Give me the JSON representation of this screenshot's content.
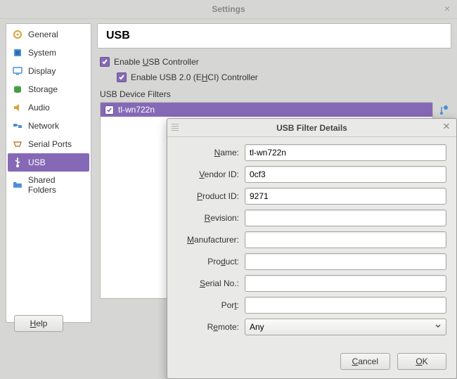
{
  "window": {
    "title": "Settings"
  },
  "sidebar": {
    "items": [
      {
        "label": "General",
        "icon": "gear",
        "selected": false
      },
      {
        "label": "System",
        "icon": "chip",
        "selected": false
      },
      {
        "label": "Display",
        "icon": "monitor",
        "selected": false
      },
      {
        "label": "Storage",
        "icon": "disk",
        "selected": false
      },
      {
        "label": "Audio",
        "icon": "speaker",
        "selected": false
      },
      {
        "label": "Network",
        "icon": "network",
        "selected": false
      },
      {
        "label": "Serial Ports",
        "icon": "serial",
        "selected": false
      },
      {
        "label": "USB",
        "icon": "usb",
        "selected": true
      },
      {
        "label": "Shared Folders",
        "icon": "folder",
        "selected": false
      }
    ]
  },
  "page": {
    "heading": "USB",
    "enable_label_pre": "Enable ",
    "enable_label_und": "U",
    "enable_label_post": "SB Controller",
    "enable_checked": true,
    "ehci_label_pre": "Enable USB 2.0 (E",
    "ehci_label_und": "H",
    "ehci_label_post": "CI) Controller",
    "ehci_checked": true,
    "filters_label": "USB Device Filters",
    "filters": [
      {
        "name": "tl-wn722n",
        "checked": true
      }
    ],
    "side_actions": [
      "add-empty-filter",
      "add-filter-from-device",
      "edit-filter",
      "remove-filter",
      "move-filter-up",
      "move-filter-down"
    ]
  },
  "footer": {
    "help_u": "H",
    "help_rest": "elp",
    "ok_u": "O",
    "ok_rest": "K"
  },
  "modal": {
    "title": "USB Filter Details",
    "fields": {
      "name": {
        "label_u": "N",
        "label_rest": "ame:",
        "value": "tl-wn722n"
      },
      "vendor": {
        "label_u": "V",
        "label_rest": "endor ID:",
        "value": "0cf3"
      },
      "product_id": {
        "label_u": "P",
        "label_rest": "roduct ID:",
        "value": "9271"
      },
      "revision": {
        "label_u": "R",
        "label_rest": "evision:",
        "value": ""
      },
      "manufacturer": {
        "label_u": "M",
        "label_rest": "anufacturer:",
        "value": ""
      },
      "product": {
        "label_pre": "Pro",
        "label_u": "d",
        "label_rest": "uct:",
        "value": ""
      },
      "serial": {
        "label_u": "S",
        "label_rest": "erial No.:",
        "value": ""
      },
      "port": {
        "label_pre": "Por",
        "label_u": "t",
        "label_rest": ":",
        "value": ""
      },
      "remote": {
        "label_pre": "R",
        "label_u": "e",
        "label_rest": "mote:",
        "value": "Any"
      }
    },
    "buttons": {
      "cancel_u": "C",
      "cancel_rest": "ancel",
      "ok_u": "O",
      "ok_rest": "K"
    }
  }
}
